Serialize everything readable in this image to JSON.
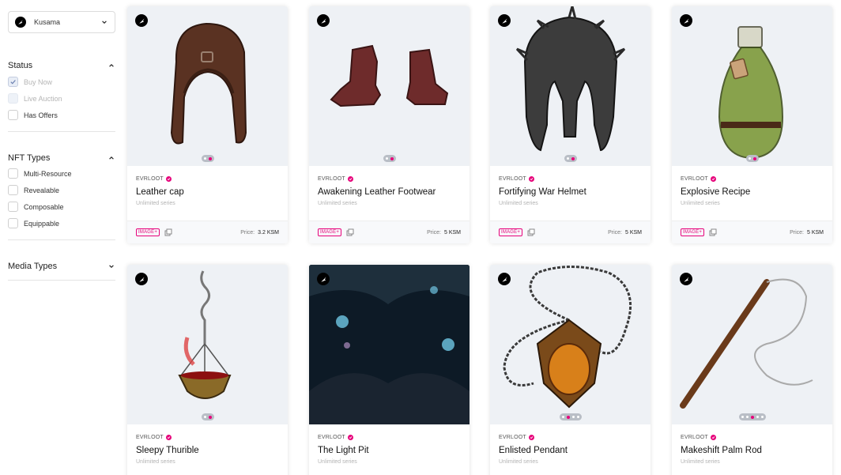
{
  "sidebar": {
    "chain": {
      "label": "Kusama",
      "icon": "kusama-logo-icon"
    },
    "status": {
      "title": "Status",
      "options": [
        {
          "label": "Buy Now",
          "checked": true,
          "disabled": true
        },
        {
          "label": "Live Auction",
          "checked": false,
          "disabled": true
        },
        {
          "label": "Has Offers",
          "checked": false,
          "disabled": false
        }
      ]
    },
    "nft_types": {
      "title": "NFT Types",
      "options": [
        {
          "label": "Multi-Resource"
        },
        {
          "label": "Revealable"
        },
        {
          "label": "Composable"
        },
        {
          "label": "Equippable"
        }
      ]
    },
    "media_types": {
      "title": "Media Types"
    }
  },
  "cards": [
    {
      "collection": "EVRLOOT",
      "name": "Leather cap",
      "series": "Unlimited series",
      "tag": "IMAGE+",
      "price_label": "Price:",
      "price": "3.2 KSM",
      "art": "leather-cap"
    },
    {
      "collection": "EVRLOOT",
      "name": "Awakening Leather Footwear",
      "series": "Unlimited series",
      "tag": "IMAGE+",
      "price_label": "Price:",
      "price": "5 KSM",
      "art": "leather-footwear"
    },
    {
      "collection": "EVRLOOT",
      "name": "Fortifying War Helmet",
      "series": "Unlimited series",
      "tag": "IMAGE+",
      "price_label": "Price:",
      "price": "5 KSM",
      "art": "war-helmet"
    },
    {
      "collection": "EVRLOOT",
      "name": "Explosive Recipe",
      "series": "Unlimited series",
      "tag": "IMAGE+",
      "price_label": "Price:",
      "price": "5 KSM",
      "art": "potion-bottle"
    },
    {
      "collection": "EVRLOOT",
      "name": "Sleepy Thurible",
      "series": "Unlimited series",
      "art": "thurible"
    },
    {
      "collection": "EVRLOOT",
      "name": "The Light Pit",
      "series": "Unlimited series",
      "art": "light-pit"
    },
    {
      "collection": "EVRLOOT",
      "name": "Enlisted Pendant",
      "series": "Unlimited series",
      "art": "pendant"
    },
    {
      "collection": "EVRLOOT",
      "name": "Makeshift Palm Rod",
      "series": "Unlimited series",
      "art": "palm-rod"
    }
  ],
  "colors": {
    "accent": "#e6007a",
    "media_bg": "#eef1f5"
  }
}
